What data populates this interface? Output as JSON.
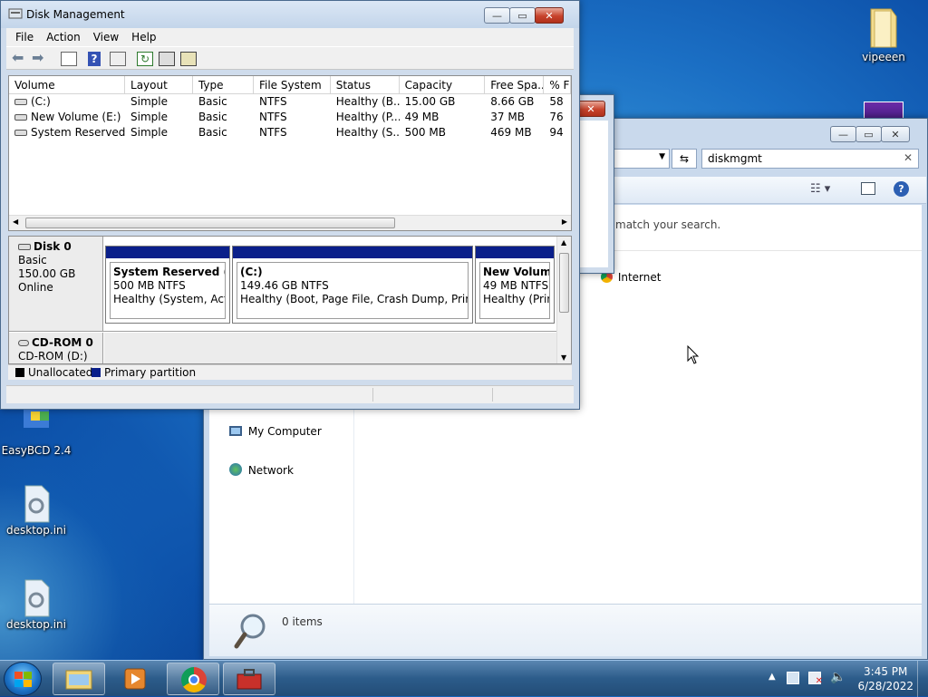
{
  "desktop": {
    "icons": [
      {
        "label": "vipeeen"
      },
      {
        "label": "EasyBCD 2.4"
      },
      {
        "label": "desktop.ini"
      },
      {
        "label": "desktop.ini"
      }
    ]
  },
  "disk_mgmt": {
    "title": "Disk Management",
    "menu": [
      "File",
      "Action",
      "View",
      "Help"
    ],
    "columns": [
      "Volume",
      "Layout",
      "Type",
      "File System",
      "Status",
      "Capacity",
      "Free Spa...",
      "% F"
    ],
    "rows": [
      {
        "volume": "(C:)",
        "layout": "Simple",
        "type": "Basic",
        "fs": "NTFS",
        "status": "Healthy (B...",
        "capacity": "15.00 GB",
        "free": "8.66 GB",
        "pct": "58"
      },
      {
        "volume": "New Volume (E:)",
        "layout": "Simple",
        "type": "Basic",
        "fs": "NTFS",
        "status": "Healthy (P...",
        "capacity": "49 MB",
        "free": "37 MB",
        "pct": "76"
      },
      {
        "volume": "System Reserved (...",
        "layout": "Simple",
        "type": "Basic",
        "fs": "NTFS",
        "status": "Healthy (S...",
        "capacity": "500 MB",
        "free": "469 MB",
        "pct": "94"
      }
    ],
    "disk0": {
      "name": "Disk 0",
      "type": "Basic",
      "size": "150.00 GB",
      "state": "Online",
      "partitions": [
        {
          "name": "System Reserved  (S:)",
          "size": "500 MB NTFS",
          "status": "Healthy (System, Active"
        },
        {
          "name": "(C:)",
          "size": "149.46 GB NTFS",
          "status": "Healthy (Boot, Page File, Crash Dump, Primary F"
        },
        {
          "name": "New Volume",
          "size": "49 MB NTFS",
          "status": "Healthy (Prim"
        }
      ]
    },
    "cdrom": {
      "name": "CD-ROM 0",
      "label": "CD-ROM (D:)"
    },
    "legend": {
      "unallocated": "Unallocated",
      "primary": "Primary partition"
    },
    "colors": {
      "unallocated": "#000000",
      "primary": "#0a1f8a"
    }
  },
  "explorer": {
    "search_value": "diskmgmt",
    "no_match": "match your search.",
    "result_item": "Internet",
    "nav": [
      "My Computer",
      "Network"
    ],
    "status": "0 items"
  },
  "taskbar": {
    "time": "3:45 PM",
    "date": "6/28/2022"
  }
}
